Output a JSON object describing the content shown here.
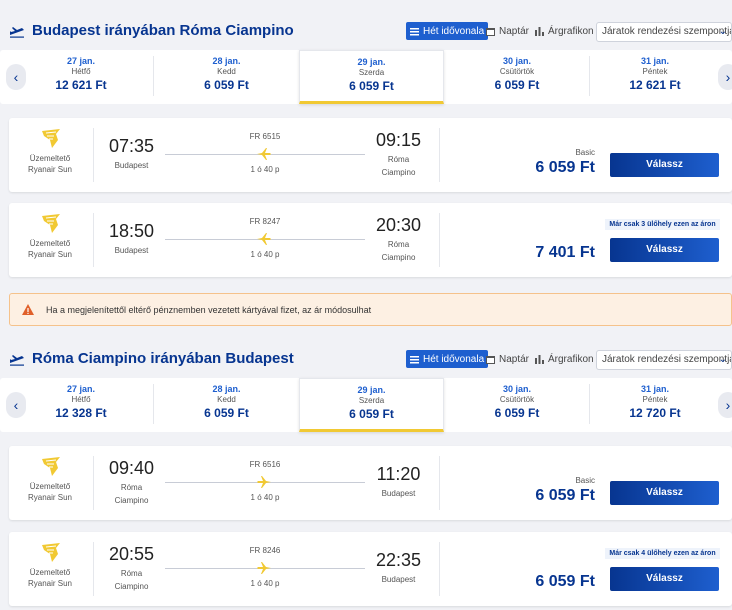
{
  "view_options": {
    "week": "Hét idővonala",
    "calendar": "Naptár",
    "price_chart": "Árgrafikon",
    "sort_label": "Járatok rendezési szempontja:"
  },
  "operator_label": "Üzemeltető",
  "operator_name": "Ryanair Sun",
  "select_label": "Válassz",
  "outbound": {
    "title": "Budapest irányában Róma Ciampino",
    "dates": [
      {
        "date": "27 jan.",
        "weekday": "Hétfő",
        "price": "12 621 Ft"
      },
      {
        "date": "28 jan.",
        "weekday": "Kedd",
        "price": "6 059 Ft"
      },
      {
        "date": "29 jan.",
        "weekday": "Szerda",
        "price": "6 059 Ft"
      },
      {
        "date": "30 jan.",
        "weekday": "Csütörtök",
        "price": "6 059 Ft"
      },
      {
        "date": "31 jan.",
        "weekday": "Péntek",
        "price": "12 621 Ft"
      }
    ],
    "flights": [
      {
        "dep_time": "07:35",
        "dep_city": "Budapest",
        "dep_city2": "",
        "arr_time": "09:15",
        "arr_city": "Róma",
        "arr_city2": "Ciampino",
        "flight_no": "FR 6515",
        "duration": "1 ó 40 p",
        "fare": "Basic",
        "price": "6 059 Ft",
        "seats": ""
      },
      {
        "dep_time": "18:50",
        "dep_city": "Budapest",
        "dep_city2": "",
        "arr_time": "20:30",
        "arr_city": "Róma",
        "arr_city2": "Ciampino",
        "flight_no": "FR 8247",
        "duration": "1 ó 40 p",
        "fare": "",
        "price": "7 401 Ft",
        "seats": "Már csak 3 ülőhely ezen az áron"
      }
    ]
  },
  "notice": "Ha a megjelenítettől eltérő pénznemben vezetett kártyával fizet, az ár módosulhat",
  "inbound": {
    "title": "Róma Ciampino irányában Budapest",
    "dates": [
      {
        "date": "27 jan.",
        "weekday": "Hétfő",
        "price": "12 328 Ft"
      },
      {
        "date": "28 jan.",
        "weekday": "Kedd",
        "price": "6 059 Ft"
      },
      {
        "date": "29 jan.",
        "weekday": "Szerda",
        "price": "6 059 Ft"
      },
      {
        "date": "30 jan.",
        "weekday": "Csütörtök",
        "price": "6 059 Ft"
      },
      {
        "date": "31 jan.",
        "weekday": "Péntek",
        "price": "12 720 Ft"
      }
    ],
    "flights": [
      {
        "dep_time": "09:40",
        "dep_city": "Róma",
        "dep_city2": "Ciampino",
        "arr_time": "11:20",
        "arr_city": "Budapest",
        "arr_city2": "",
        "flight_no": "FR 6516",
        "duration": "1 ó 40 p",
        "fare": "Basic",
        "price": "6 059 Ft",
        "seats": ""
      },
      {
        "dep_time": "20:55",
        "dep_city": "Róma",
        "dep_city2": "Ciampino",
        "arr_time": "22:35",
        "arr_city": "Budapest",
        "arr_city2": "",
        "flight_no": "FR 8246",
        "duration": "1 ó 40 p",
        "fare": "",
        "price": "6 059 Ft",
        "seats": "Már csak 4 ülőhely ezen az áron"
      }
    ]
  },
  "colors": {
    "brand": "#073590",
    "accent": "#f1c933",
    "button": "#1e5fcf"
  }
}
